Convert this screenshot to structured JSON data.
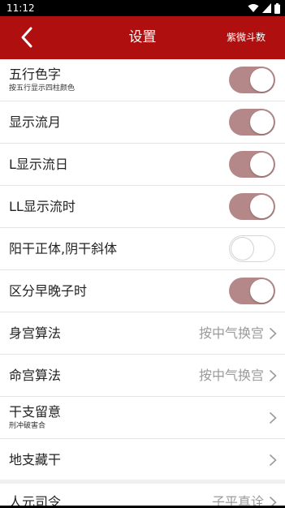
{
  "status_bar": {
    "time": "11:12",
    "icons": [
      "wifi-icon",
      "signal-icon",
      "battery-icon"
    ]
  },
  "app_bar": {
    "back_icon": "chevron-left-icon",
    "title": "设置",
    "action_label": "紫微斗数",
    "color": "#b00f0f"
  },
  "colors": {
    "toggle_on": "#b48888",
    "value_text": "#9a9a9a"
  },
  "settings": {
    "wuxing_color": {
      "label": "五行色字",
      "sub": "按五行显示四柱颜色",
      "on": true
    },
    "show_liuyue": {
      "label": "显示流月",
      "on": true
    },
    "show_liuri": {
      "label": "L显示流日",
      "on": true
    },
    "show_liushi": {
      "label": "LL显示流时",
      "on": true
    },
    "yang_yin_style": {
      "label": "阳干正体,阴干斜体",
      "on": false
    },
    "early_late_zi": {
      "label": "区分早晚子时",
      "on": true
    },
    "shengong": {
      "label": "身宫算法",
      "value": "按中气换宫"
    },
    "minggong": {
      "label": "命宫算法",
      "value": "按中气换宫"
    },
    "ganzhi_notes": {
      "label": "干支留意",
      "sub": "刑冲破害合"
    },
    "dizhi_canggan": {
      "label": "地支藏干"
    },
    "renyuan_siling": {
      "label": "人元司令",
      "value": "子平真诠"
    }
  }
}
